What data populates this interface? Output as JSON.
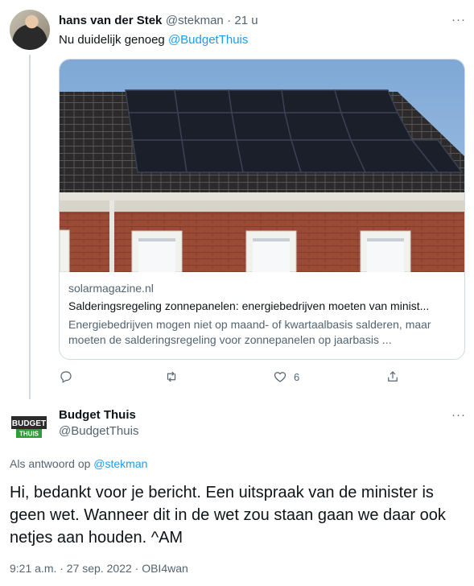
{
  "tweet1": {
    "name": "hans van der Stek",
    "handle": "@stekman",
    "time": "· 21 u",
    "text_prefix": "Nu duidelijk genoeg ",
    "mention": "@BudgetThuis",
    "card": {
      "domain": "solarmagazine.nl",
      "title": "Salderingsregeling zonnepanelen: energiebedrijven moeten van minist...",
      "description": "Energiebedrijven mogen niet op maand- of kwartaalbasis salderen, maar moeten de salderingsregeling voor zonnepanelen op jaarbasis ..."
    },
    "actions": {
      "like_count": "6"
    },
    "more": "···"
  },
  "tweet2": {
    "name": "Budget Thuis",
    "handle": "@BudgetThuis",
    "logo_top": "BUDGET",
    "logo_bottom": "THUIS",
    "reply_prefix": "Als antwoord op ",
    "reply_to": "@stekman",
    "text": "Hi, bedankt voor je bericht. Een uitspraak van de minister is geen wet. Wanneer dit in de wet zou staan gaan we daar ook netjes aan houden.  ^AM",
    "meta": "9:21 a.m. · 27 sep. 2022 · OBI4wan",
    "more": "···"
  },
  "colors": {
    "link": "#1d9bf0",
    "muted": "#536471",
    "border": "#cfd9de",
    "brand_green": "#2e9e3a"
  },
  "icons": [
    "reply-icon",
    "retweet-icon",
    "like-icon",
    "share-icon",
    "more-icon"
  ]
}
